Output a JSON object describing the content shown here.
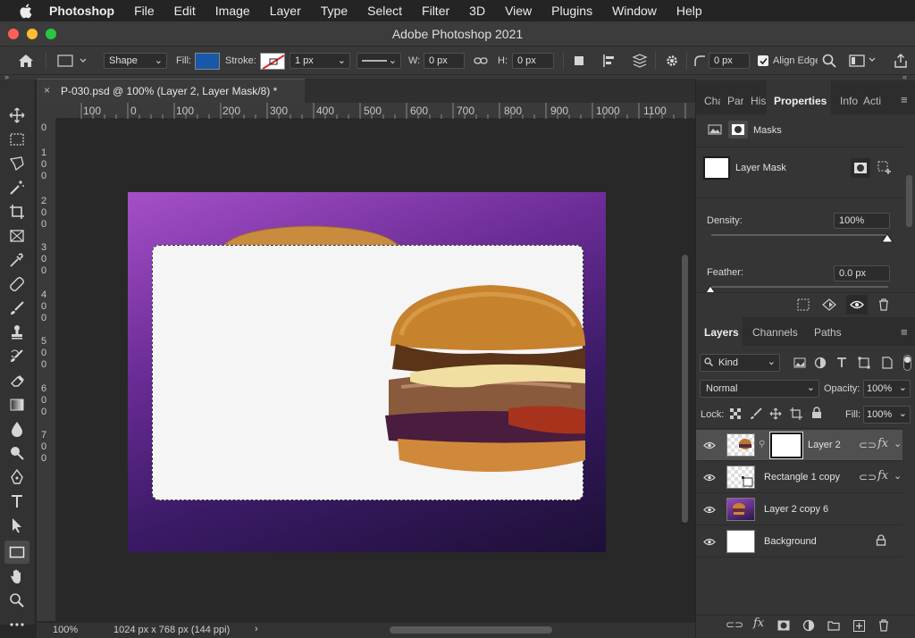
{
  "menubar": {
    "items": [
      "Photoshop",
      "File",
      "Edit",
      "Image",
      "Layer",
      "Type",
      "Select",
      "Filter",
      "3D",
      "View",
      "Plugins",
      "Window",
      "Help"
    ]
  },
  "window": {
    "title": "Adobe Photoshop 2021"
  },
  "options_bar": {
    "mode": "Shape",
    "fill_label": "Fill:",
    "fill_color": "#1758a8",
    "stroke_label": "Stroke:",
    "stroke_width": "1 px",
    "w_label": "W:",
    "w_value": "0 px",
    "h_label": "H:",
    "h_value": "0 px",
    "radius_value": "0 px",
    "align_edges_label": "Align Edges",
    "align_edges_checked": true
  },
  "document": {
    "tab_title": "P-030.psd @ 100% (Layer 2, Layer Mask/8) *",
    "ruler_h": [
      "100",
      "0",
      "100",
      "200",
      "300",
      "400",
      "500",
      "600",
      "700",
      "800",
      "900",
      "1000",
      "1100"
    ],
    "ruler_v": [
      "0",
      "1\n0\n0",
      "2\n0\n0",
      "3\n0\n0",
      "4\n0\n0",
      "5\n0\n0",
      "6\n0\n0",
      "7\n0\n0"
    ],
    "zoom": "100%",
    "doc_info": "1024 px x 768 px (144 ppi)"
  },
  "properties_panel": {
    "tabs": [
      "Cha",
      "Par",
      "His",
      "Properties",
      "Info",
      "Acti"
    ],
    "active_tab": "Properties",
    "masks_label": "Masks",
    "layer_mask_label": "Layer Mask",
    "density_label": "Density:",
    "density_value": "100%",
    "feather_label": "Feather:",
    "feather_value": "0.0 px"
  },
  "layers_panel": {
    "tabs": [
      "Layers",
      "Channels",
      "Paths"
    ],
    "active_tab": "Layers",
    "filter_kind": "Kind",
    "blend_mode": "Normal",
    "opacity_label": "Opacity:",
    "opacity_value": "100%",
    "lock_label": "Lock:",
    "fill_label": "Fill:",
    "fill_value": "100%",
    "layers": [
      {
        "name": "Layer 2",
        "selected": true,
        "has_mask": true,
        "has_fx": true,
        "visible": true
      },
      {
        "name": "Rectangle 1 copy",
        "selected": false,
        "has_fx": true,
        "visible": true
      },
      {
        "name": "Layer 2 copy 6",
        "selected": false,
        "visible": true
      },
      {
        "name": "Background",
        "selected": false,
        "locked": true,
        "visible": true
      }
    ]
  },
  "colors": {
    "accent_blue": "#1758a8",
    "panel_bg": "#353535",
    "canvas_bg": "#282828",
    "purple_light": "#a54fc8",
    "purple_dark": "#1d1036"
  }
}
